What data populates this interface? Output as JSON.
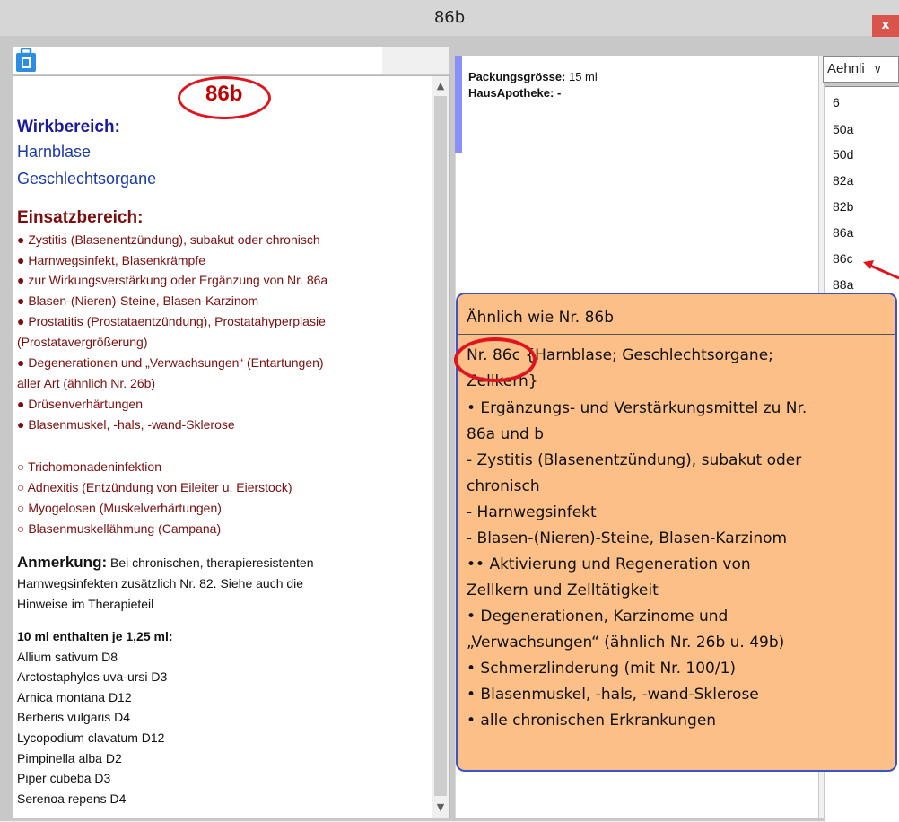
{
  "window": {
    "title": "86b",
    "close_label": "x"
  },
  "left": {
    "number": "86b",
    "wirk_heading": "Wirkbereich:",
    "wirk_items": [
      "Harnblase",
      "Geschlechtsorgane"
    ],
    "einsatz_heading": "Einsatzbereich:",
    "einsatz_items": [
      "● Zystitis (Blasenentzündung), subakut oder chronisch",
      "● Harnwegsinfekt, Blasenkrämpfe",
      "● zur Wirkungsverstärkung oder Ergänzung von Nr. 86a",
      "● Blasen-(Nieren)-Steine, Blasen-Karzinom",
      "● Prostatitis (Prostataentzündung), Prostatahyperplasie",
      "(Prostatavergrößerung)",
      "● Degenerationen und „Verwachsungen“ (Entartungen)",
      "aller Art (ähnlich Nr. 26b)",
      "● Drüsenverhärtungen",
      "● Blasenmuskel, -hals, -wand-Sklerose"
    ],
    "einsatz_items2": [
      "○ Trichomonadeninfektion",
      "○ Adnexitis (Entzündung von Eileiter u. Eierstock)",
      "○ Myogelosen (Muskelverhärtungen)",
      "○ Blasenmuskellähmung (Campana)"
    ],
    "anmerkung_label": "Anmerkung:",
    "anmerkung_text1": " Bei chronischen, therapieresistenten",
    "anmerkung_text2": "Harnwegsinfekten zusätzlich Nr. 82. Siehe auch die",
    "anmerkung_text3": "Hinweise im Therapieteil",
    "ingredients_heading": "10 ml enthalten je 1,25 ml:",
    "ingredients": [
      "Allium sativum D8",
      "Arctostaphylos uva-ursi D3",
      "Arnica montana D12",
      "Berberis vulgaris D4",
      "Lycopodium clavatum D12",
      "Pimpinella alba D2",
      "Piper cubeba D3",
      "Serenoa repens D4"
    ]
  },
  "middle": {
    "packung_label": "Packungsgrösse:",
    "packung_value": " 15 ml",
    "haus_label": "HausApotheke:",
    "haus_value": " -"
  },
  "right": {
    "dropdown_value": "Aehnli",
    "dropdown_arrow": "∨",
    "list": [
      "6",
      "50a",
      "50d",
      "82a",
      "82b",
      "86a",
      "86c",
      "88a"
    ]
  },
  "tooltip": {
    "title": "Ähnlich wie Nr. 86b",
    "lines": [
      "Nr. 86c {Harnblase; Geschlechtsorgane;",
      "Zellkern}",
      "• Ergänzungs- und Verstärkungsmittel zu Nr.",
      "86a und b",
      "  - Zystitis (Blasenentzündung), subakut oder",
      "chronisch",
      "  - Harnwegsinfekt",
      "  - Blasen-(Nieren)-Steine, Blasen-Karzinom",
      "•• Aktivierung und Regeneration von",
      "Zellkern und Zelltätigkeit",
      "• Degenerationen, Karzinome und",
      "„Verwachsungen“ (ähnlich Nr. 26b u. 49b)",
      "• Schmerzlinderung (mit Nr. 100/1)",
      "• Blasenmuskel, -hals, -wand-Sklerose",
      "• alle chronischen Erkrankungen"
    ]
  },
  "colors": {
    "tooltip_bg": "#fbbf87",
    "tooltip_border": "#3a53c8",
    "annotation_red": "#e0141e",
    "close_red": "#d9554b"
  }
}
